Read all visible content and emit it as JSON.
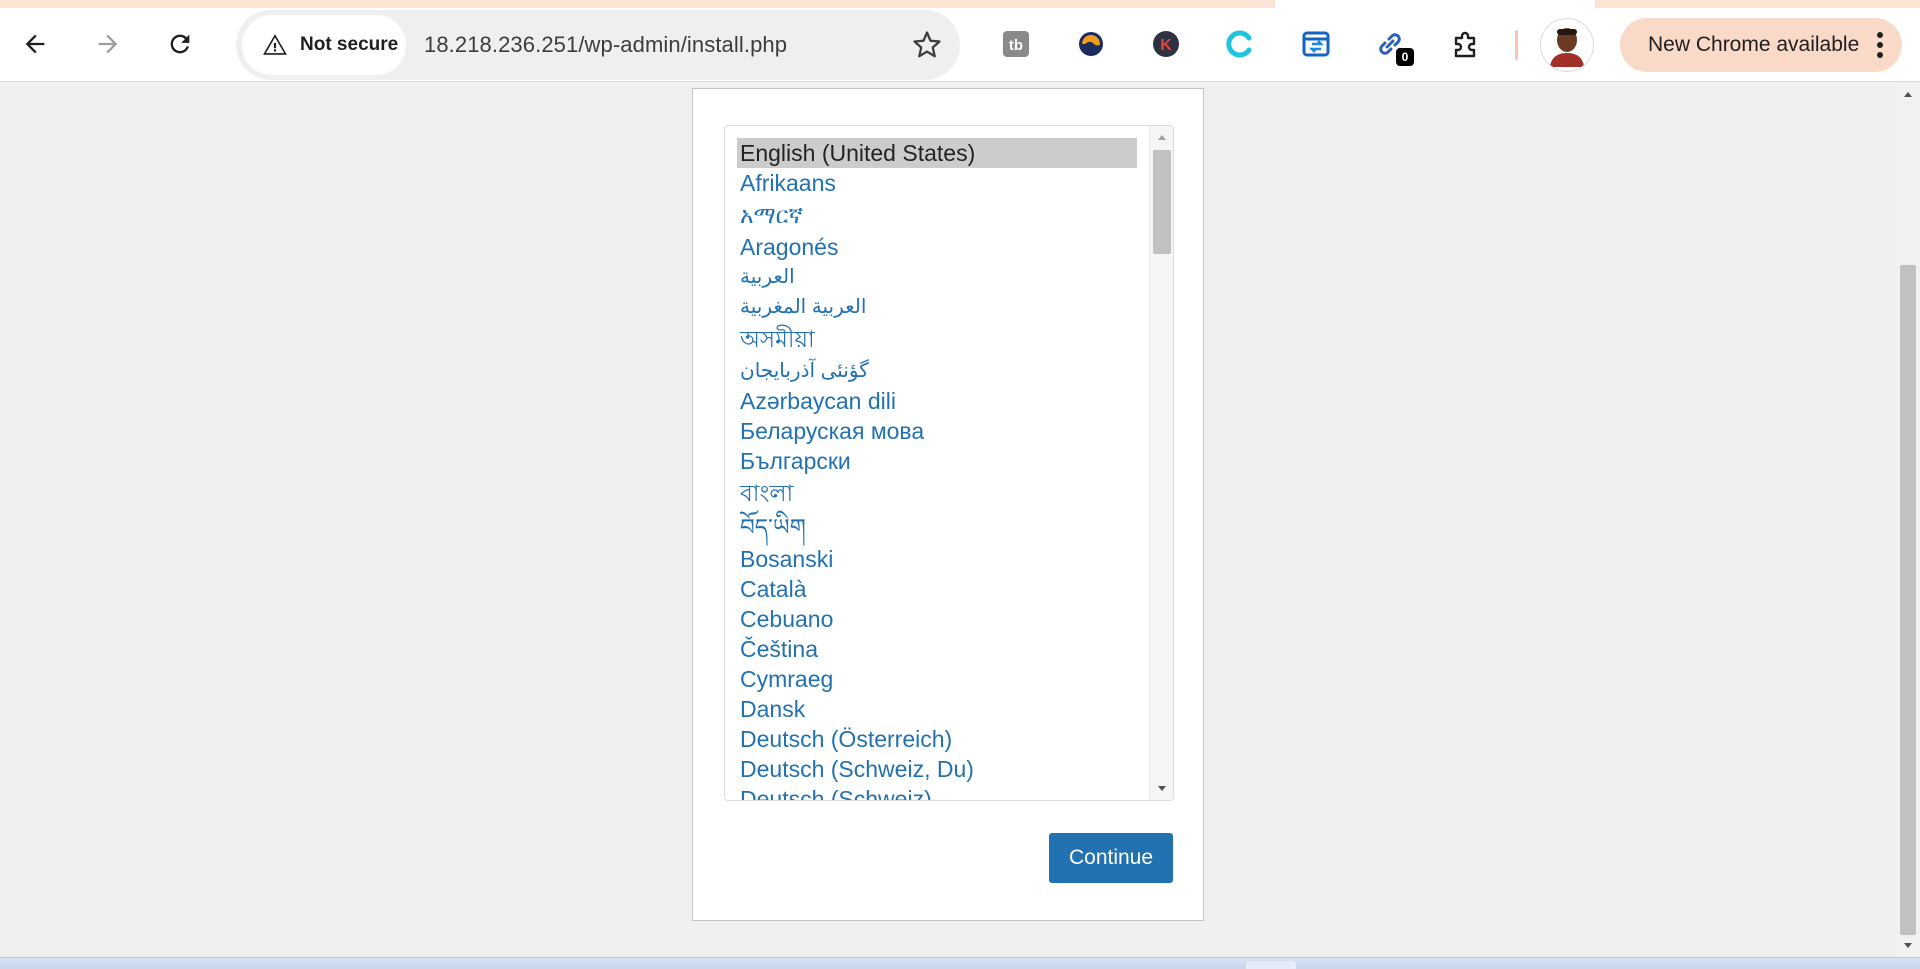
{
  "browser": {
    "security_label": "Not secure",
    "url": "18.218.236.251/wp-admin/install.php",
    "update_label": "New Chrome available",
    "extensions": [
      {
        "name": "tb-extension-icon",
        "label": "tb"
      },
      {
        "name": "orange-swirl-extension-icon"
      },
      {
        "name": "k-extension-icon",
        "label": "K"
      },
      {
        "name": "cyan-c-extension-icon"
      },
      {
        "name": "blue-doc-extension-icon"
      },
      {
        "name": "link-extension-icon",
        "badge": "0"
      },
      {
        "name": "puzzle-icon"
      }
    ],
    "colors": {
      "accent": "#2271b1",
      "update_chip": "#f9d9c8"
    }
  },
  "installer": {
    "languages": [
      "English (United States)",
      "Afrikaans",
      "አማርኛ",
      "Aragonés",
      "العربية",
      "العربية المغربية",
      "অসমীয়া",
      "گؤنئی آذربایجان",
      "Azərbaycan dili",
      "Беларуская мова",
      "Български",
      "বাংলা",
      "བོད་ཡིག",
      "Bosanski",
      "Català",
      "Cebuano",
      "Čeština",
      "Cymraeg",
      "Dansk",
      "Deutsch (Österreich)",
      "Deutsch (Schweiz, Du)",
      "Deutsch (Schweiz)"
    ],
    "selected_language": "English (United States)",
    "continue_label": "Continue"
  }
}
